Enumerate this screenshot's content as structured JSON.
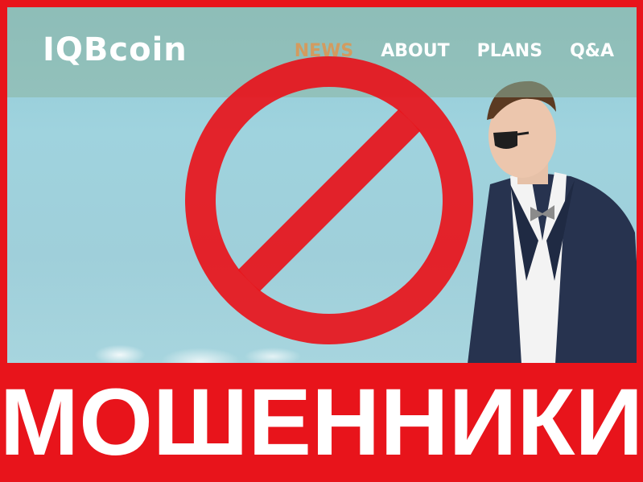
{
  "site": {
    "logo_text": "IQBcoin",
    "nav": [
      {
        "label": "NEWS",
        "active": true
      },
      {
        "label": "ABOUT",
        "active": false
      },
      {
        "label": "PLANS",
        "active": false
      },
      {
        "label": "Q&A",
        "active": false
      }
    ]
  },
  "overlay": {
    "icon": "prohibited-icon",
    "color": "#e8141b"
  },
  "banner": {
    "text": "МОШЕННИКИ",
    "background": "#e8141b"
  },
  "colors": {
    "nav_active": "#d39b5f",
    "sky": "#9fd3de"
  }
}
